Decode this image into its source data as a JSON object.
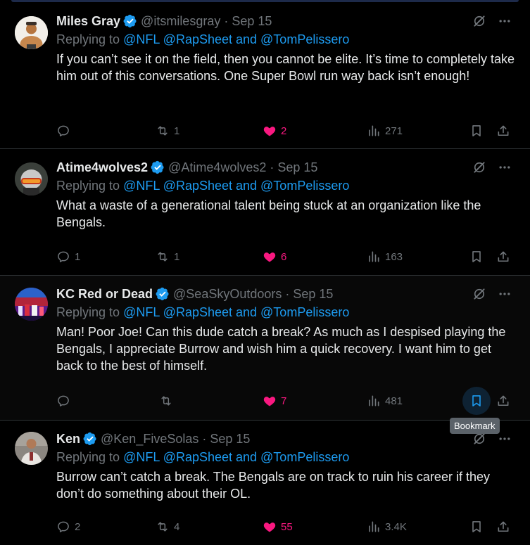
{
  "tweets": [
    {
      "name": "Miles Gray",
      "handle": "@itsmilesgray",
      "dot": "·",
      "date": "Sep 15",
      "replying_prefix": "Replying to ",
      "reply_links": "@NFL @RapSheet and @TomPelissero",
      "body": "If you can’t see it on the field, then you cannot be elite. It’s time to completely take him out of this conversations. One Super Bowl run way back isn’t enough!",
      "replies": "",
      "reposts": "1",
      "likes": "2",
      "views": "271"
    },
    {
      "name": "Atime4wolves2",
      "handle": "@Atime4wolves2",
      "dot": "·",
      "date": "Sep 15",
      "replying_prefix": "Replying to ",
      "reply_links": "@NFL @RapSheet and @TomPelissero",
      "body": "What a waste of a generational talent being stuck at an organization like the Bengals.",
      "replies": "1",
      "reposts": "1",
      "likes": "6",
      "views": "163"
    },
    {
      "name": "KC Red or Dead",
      "handle": "@SeaSkyOutdoors",
      "dot": "·",
      "date": "Sep 15",
      "replying_prefix": "Replying to ",
      "reply_links": "@NFL @RapSheet and @TomPelissero",
      "body": "Man! Poor Joe! Can this dude catch a break? As much as I despised playing the Bengals, I appreciate Burrow and wish him a quick recovery. I want him to get back to the best of himself.",
      "replies": "",
      "reposts": "",
      "likes": "7",
      "views": "481"
    },
    {
      "name": "Ken",
      "handle": "@Ken_FiveSolas",
      "dot": "·",
      "date": "Sep 15",
      "replying_prefix": "Replying to ",
      "reply_links": "@NFL @RapSheet and @TomPelissero",
      "body": "Burrow can’t catch a break. The Bengals are on track to ruin his career if they don’t do something about their OL.",
      "replies": "2",
      "reposts": "4",
      "likes": "55",
      "views": "3.4K"
    }
  ],
  "tooltip": "Bookmark",
  "colors": {
    "accent": "#1d9bf0",
    "like": "#f91880",
    "muted": "#71767b",
    "text": "#e7e9ea",
    "divider": "#2f3336"
  },
  "icons": [
    "verified-badge-icon",
    "grok-icon",
    "more-icon",
    "reply-icon",
    "repost-icon",
    "heart-icon",
    "views-icon",
    "bookmark-icon",
    "share-icon"
  ]
}
